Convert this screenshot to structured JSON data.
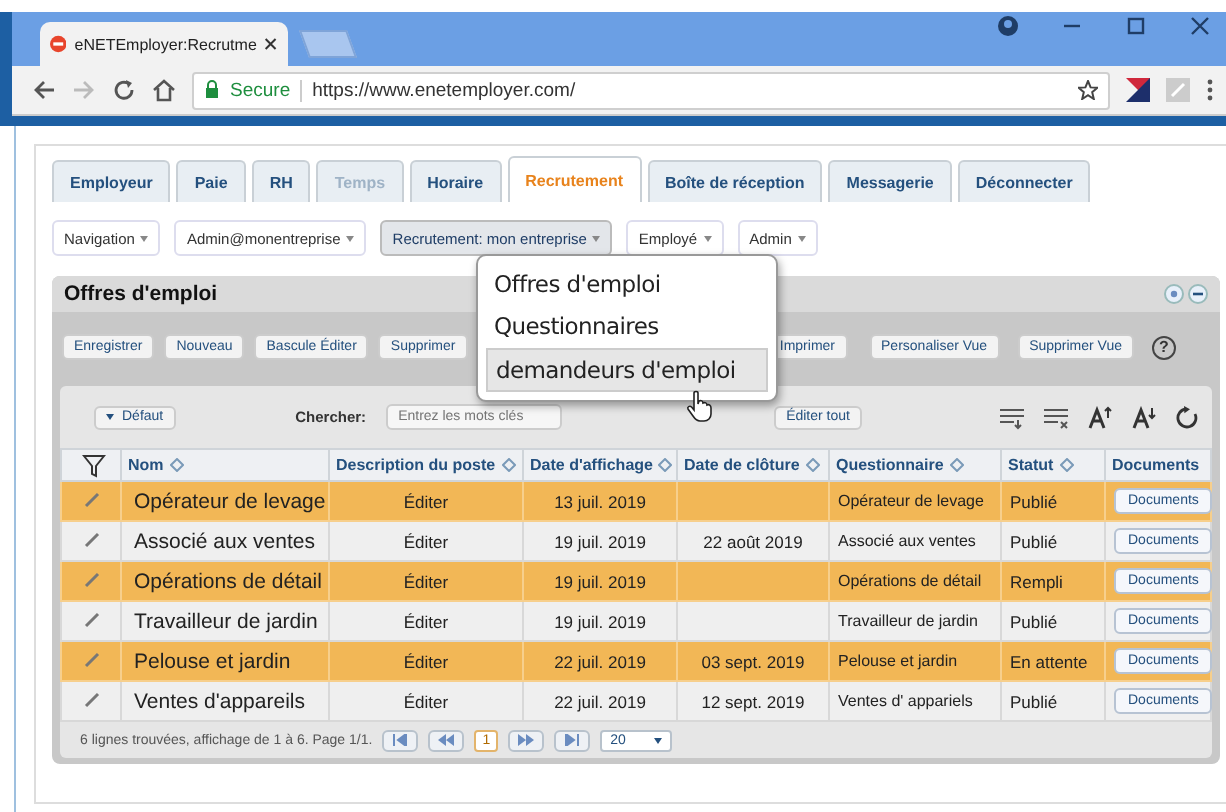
{
  "browser": {
    "tab_title": "eNETEmployer:Recrutme",
    "secure_label": "Secure",
    "url": "https://www.enetemployer.com/"
  },
  "tabs": [
    {
      "label": "Employeur",
      "selected": false,
      "disabled": false
    },
    {
      "label": "Paie",
      "selected": false,
      "disabled": false
    },
    {
      "label": "RH",
      "selected": false,
      "disabled": false
    },
    {
      "label": "Temps",
      "selected": false,
      "disabled": true
    },
    {
      "label": "Horaire",
      "selected": false,
      "disabled": false
    },
    {
      "label": "Recrutement",
      "selected": true,
      "disabled": false
    },
    {
      "label": "Boîte de réception",
      "selected": false,
      "disabled": false
    },
    {
      "label": "Messagerie",
      "selected": false,
      "disabled": false
    },
    {
      "label": "Déconnecter",
      "selected": false,
      "disabled": false
    }
  ],
  "nav_menus": [
    {
      "label": "Navigation",
      "selected": false
    },
    {
      "label": "Admin@monentreprise",
      "selected": false
    },
    {
      "label": "Recrutement: mon entreprise",
      "selected": true
    },
    {
      "label": "Employé",
      "selected": false
    },
    {
      "label": "Admin",
      "selected": false
    }
  ],
  "dropdown": [
    {
      "label": "Offres d'emploi",
      "hovered": false
    },
    {
      "label": "Questionnaires",
      "hovered": false
    },
    {
      "label": "demandeurs d'emploi",
      "hovered": true
    }
  ],
  "panel": {
    "title": "Offres d'emploi"
  },
  "toolbar": {
    "left": [
      "Enregistrer",
      "Nouveau",
      "Bascule Éditer",
      "Supprimer"
    ],
    "right": [
      "Imprimer",
      "Personaliser Vue",
      "Supprimer Vue"
    ],
    "help": "?"
  },
  "grid_toolbar": {
    "view": "Défaut",
    "search_label": "Chercher:",
    "search_placeholder": "Entrez les mots clés",
    "edit_all": "Éditer tout"
  },
  "columns": [
    {
      "label": "Nom",
      "sortable": true
    },
    {
      "label": "Description du poste",
      "sortable": true
    },
    {
      "label": "Date d'affichage",
      "sortable": true
    },
    {
      "label": "Date de clôture",
      "sortable": true
    },
    {
      "label": "Questionnaire",
      "sortable": true
    },
    {
      "label": "Statut",
      "sortable": true
    },
    {
      "label": "Documents",
      "sortable": false
    }
  ],
  "rows": [
    {
      "name": "Opérateur de levage",
      "description": "Éditer",
      "posted": "13 juil. 2019",
      "closing": "",
      "questionnaire": "Opérateur de levage",
      "status": "Publié",
      "documents": "Documents",
      "highlighted": true
    },
    {
      "name": "Associé aux ventes",
      "description": "Éditer",
      "posted": "19 juil. 2019",
      "closing": "22 août 2019",
      "questionnaire": "Associé aux ventes",
      "status": "Publié",
      "documents": "Documents",
      "highlighted": false
    },
    {
      "name": "Opérations de détail",
      "description": "Éditer",
      "posted": "19 juil. 2019",
      "closing": "",
      "questionnaire": "Opérations de détail",
      "status": "Rempli",
      "documents": "Documents",
      "highlighted": true
    },
    {
      "name": "Travailleur de jardin",
      "description": "Éditer",
      "posted": "19 juil. 2019",
      "closing": "",
      "questionnaire": "Travailleur de jardin",
      "status": "Publié",
      "documents": "Documents",
      "highlighted": false
    },
    {
      "name": "Pelouse et jardin",
      "description": "Éditer",
      "posted": "22 juil. 2019",
      "closing": "03 sept. 2019",
      "questionnaire": "Pelouse et jardin",
      "status": "En attente",
      "documents": "Documents",
      "highlighted": true
    },
    {
      "name": "Ventes d'appareils",
      "description": "Éditer",
      "posted": "22 juil. 2019",
      "closing": "12 sept. 2019",
      "questionnaire": "Ventes d' appariels",
      "status": "Publié",
      "documents": "Documents",
      "highlighted": false
    }
  ],
  "footer": {
    "summary": "6 lignes trouvées, affichage de 1 à 6. Page 1/1.",
    "page": "1",
    "page_size": "20"
  }
}
